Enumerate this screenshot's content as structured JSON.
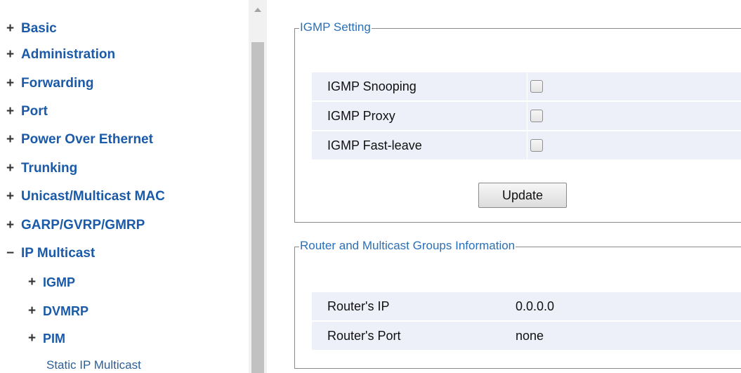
{
  "sidebar": {
    "items": [
      {
        "sign": "+",
        "label": "Basic"
      },
      {
        "sign": "+",
        "label": "Administration"
      },
      {
        "sign": "+",
        "label": "Forwarding"
      },
      {
        "sign": "+",
        "label": "Port"
      },
      {
        "sign": "+",
        "label": "Power Over Ethernet"
      },
      {
        "sign": "+",
        "label": "Trunking"
      },
      {
        "sign": "+",
        "label": "Unicast/Multicast MAC"
      },
      {
        "sign": "+",
        "label": "GARP/GVRP/GMRP"
      },
      {
        "sign": "−",
        "label": "IP Multicast"
      }
    ],
    "subitems": [
      {
        "sign": "+",
        "label": "IGMP"
      },
      {
        "sign": "+",
        "label": "DVMRP"
      },
      {
        "sign": "+",
        "label": "PIM"
      }
    ],
    "leaf": {
      "label": "Static IP Multicast"
    }
  },
  "igmp_setting": {
    "legend": "IGMP Setting",
    "rows": [
      {
        "label": "IGMP Snooping",
        "checked": false
      },
      {
        "label": "IGMP Proxy",
        "checked": false
      },
      {
        "label": "IGMP Fast-leave",
        "checked": false
      }
    ],
    "update_label": "Update"
  },
  "router_info": {
    "legend": "Router and Multicast Groups Information",
    "rows": [
      {
        "label": "Router's IP",
        "value": "0.0.0.0"
      },
      {
        "label": "Router's Port",
        "value": "none"
      }
    ]
  },
  "colors": {
    "nav_link": "#1a5aa8",
    "legend": "#2a6fb8",
    "row_bg": "#eef0f9"
  }
}
